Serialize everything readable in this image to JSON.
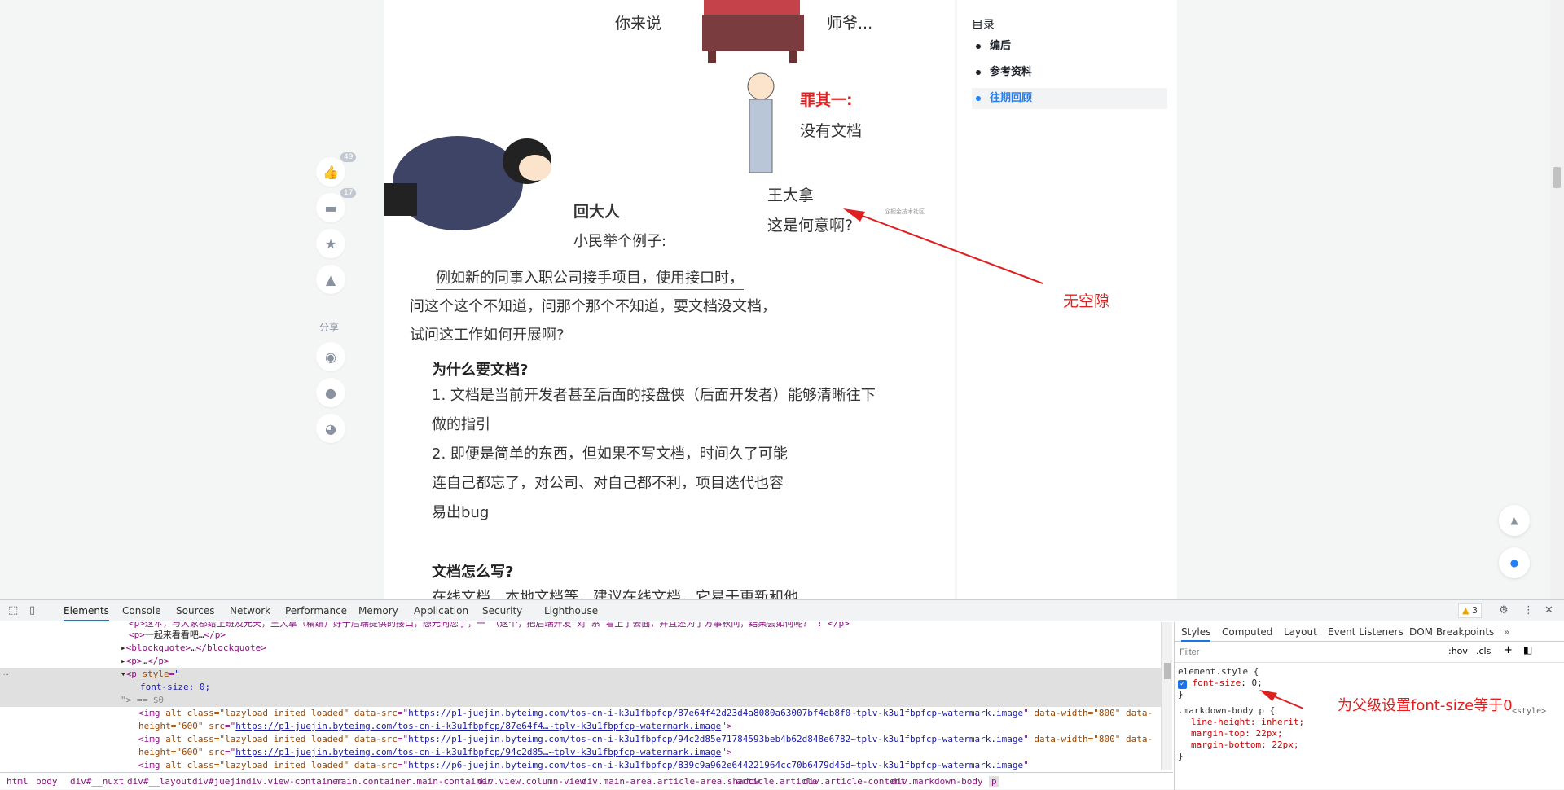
{
  "comic": {
    "line_ni_lai_shuo": "你来说",
    "line_shiye": "师爷...",
    "sin_label": "罪其一:",
    "sin_text": "没有文档",
    "kneel_title": "回大人",
    "kneel_text": "小民举个例子:",
    "wang_name": "王大拿",
    "wang_question": "这是何意啊?",
    "watermark": "@掘金技术社区"
  },
  "article": {
    "para1": "例如新的同事入职公司接手项目，使用接口时，",
    "para2": "问这个这个不知道，问那个那个不知道，要文档没文档，",
    "para3": "试问这工作如何开展啊?",
    "why_head": "为什么要文档?",
    "why_1a": "1. 文档是当前开发者甚至后面的接盘侠（后面开发者）能够清晰往下",
    "why_1b": "做的指引",
    "why_2a": "2. 即便是简单的东西，但如果不写文档，时间久了可能",
    "why_2b": "连自己都忘了，对公司、对自己都不利，项目迭代也容",
    "why_2c": "易出bug",
    "how_head": "文档怎么写?",
    "how_text": "在线文档、本地文档等，建议在线文档，它易于更新和他"
  },
  "left_panel": {
    "like_count": "49",
    "comment_count": "17",
    "share_label": "分享"
  },
  "toc": {
    "title": "目录",
    "items": [
      {
        "label": "编后",
        "active": false
      },
      {
        "label": "参考资料",
        "active": false
      },
      {
        "label": "往期回顾",
        "active": true
      }
    ]
  },
  "annotations": {
    "no_gap": "无空隙",
    "parent_font": "为父级设置font-size等于0"
  },
  "devtools": {
    "tabs": [
      "Elements",
      "Console",
      "Sources",
      "Network",
      "Performance",
      "Memory",
      "Application",
      "Security",
      "Lighthouse"
    ],
    "warning_count": "3",
    "elements": {
      "line0": "<p>这本，与大家都给上班及元天，王大拿（精编）好于后端提供的接口，想元向您了，一 （这个，把后端开发“对”系”看上了去面，并且还为了方事秋问，结果会如何呢？ ! </p>",
      "line1_text": "一起来看看吧…",
      "blockquote": "blockquote",
      "p_collapsed": "p",
      "p_style_attr": "style",
      "p_style_val": "\"",
      "font_size_line": "font-size: 0;",
      "eq_s0": "\"> == $0",
      "img1_src1": "https://p1-juejin.byteimg.com/tos-cn-i-k3u1fbpfcp/87e64f42d23d4a8080a63007bf4eb8f0~tplv-k3u1fbpfcp-watermark.image",
      "img1_src2": "https://p1-juejin.byteimg.com/tos-cn-i-k3u1fbpfcp/87e64f4…~tplv-k3u1fbpfcp-watermark.image",
      "img2_src1": "https://p1-juejin.byteimg.com/tos-cn-i-k3u1fbpfcp/94c2d85e71784593beb4b62d848e6782~tplv-k3u1fbpfcp-watermark.image",
      "img2_src2": "https://p1-juejin.byteimg.com/tos-cn-i-k3u1fbpfcp/94c2d85…~tplv-k3u1fbpfcp-watermark.image",
      "img3_src1": "https://p6-juejin.byteimg.com/tos-cn-i-k3u1fbpfcp/839c9a962e644221964cc70b6479d45d~tplv-k3u1fbpfcp-watermark.image",
      "img_alt_class": "alt class=\"lazyload inited loaded\"",
      "data_src": "data-src",
      "data_width": "data-width=\"800\"",
      "data": "data-",
      "height_600": "height=\"600\"",
      "src": "src"
    },
    "breadcrumb": [
      "html",
      "body",
      "div#__nuxt",
      "div#__layout",
      "div#juejin",
      "div.view-container",
      "main.container.main-container",
      "div.view.column-view",
      "div.main-area.article-area.shadow",
      "article.article",
      "div.article-content",
      "div.markdown-body",
      "p"
    ],
    "styles_tabs": [
      "Styles",
      "Computed",
      "Layout",
      "Event Listeners",
      "DOM Breakpoints"
    ],
    "filter_placeholder": "Filter",
    "hov": ":hov",
    "cls": ".cls",
    "element_style": "element.style {",
    "font_size_prop": "font-size",
    "font_size_val": "0;",
    "close_brace": "}",
    "md_selector": ".markdown-body p {",
    "style_source": "<style>",
    "line_height": "line-height: inherit;",
    "margin_top": "margin-top: 22px;",
    "margin_bottom": "margin-bottom: 22px;"
  }
}
